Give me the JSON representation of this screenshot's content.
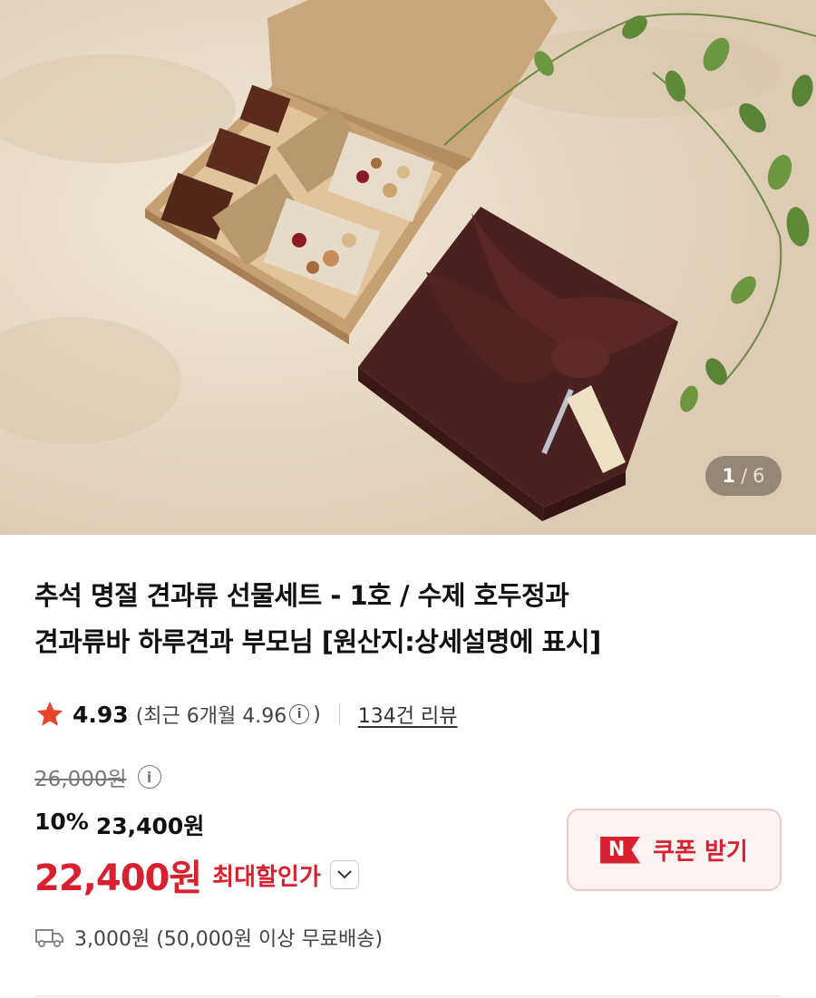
{
  "image_counter": {
    "current": "1",
    "separator": "/",
    "total": "6"
  },
  "product": {
    "title_line1": "추석 명절 견과류 선물세트 - 1호 / 수제 호두정과",
    "title_line2": "견과류바 하루견과 부모님 [원산지:상세설명에 표시]"
  },
  "rating": {
    "score": "4.93",
    "recent_open": "(최근 6개월 4.96",
    "recent_close": ")",
    "reviews_link": "134건 리뷰"
  },
  "price": {
    "original": "26,000원",
    "discount_rate": "10%",
    "discounted": "23,400원",
    "final": "22,400원",
    "final_label": "최대할인가"
  },
  "coupon": {
    "logo_letter": "N",
    "label": "쿠폰 받기"
  },
  "shipping": {
    "text": "3,000원 (50,000원 이상 무료배송)"
  },
  "colors": {
    "accent": "#d8202f",
    "star": "#e8452c",
    "coupon_bg": "#fdf3f3"
  },
  "icons": [
    "star-icon",
    "info-icon",
    "chevron-down-icon",
    "truck-icon"
  ]
}
